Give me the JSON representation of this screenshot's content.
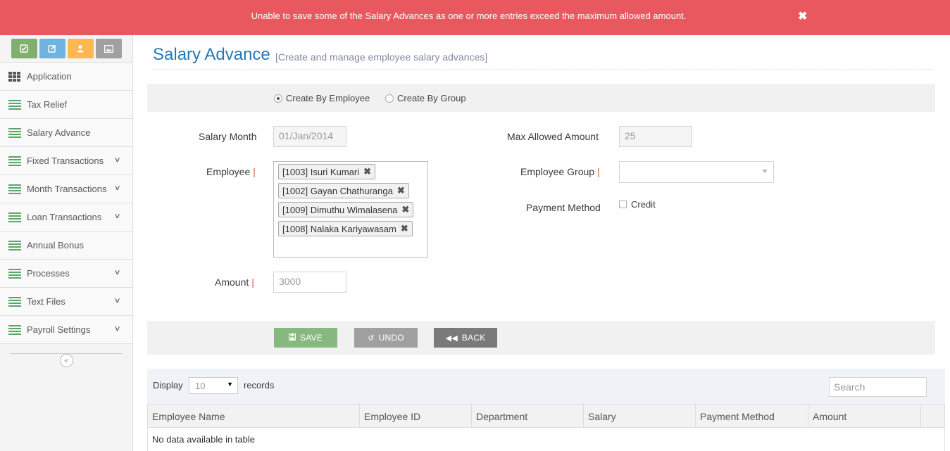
{
  "alert": {
    "message": "Unable to save some of the Salary Advances as one or more entries exceed the maximum allowed amount.",
    "close_icon": "close-icon"
  },
  "sidebar": {
    "shortcuts": [
      {
        "name": "check-square-icon",
        "color": "#82af6f"
      },
      {
        "name": "edit-icon",
        "color": "#6fb3e0"
      },
      {
        "name": "user-icon",
        "color": "#ffb752"
      },
      {
        "name": "picture-icon",
        "color": "#a0a0a0"
      }
    ],
    "items": [
      {
        "label": "Application",
        "icon": "grid-icon",
        "has_submenu": false
      },
      {
        "label": "Tax Relief",
        "icon": "list-icon",
        "has_submenu": false
      },
      {
        "label": "Salary Advance",
        "icon": "list-icon",
        "has_submenu": false
      },
      {
        "label": "Fixed Transactions",
        "icon": "list-icon",
        "has_submenu": true
      },
      {
        "label": "Month Transactions",
        "icon": "list-icon",
        "has_submenu": true
      },
      {
        "label": "Loan Transactions",
        "icon": "list-icon",
        "has_submenu": true
      },
      {
        "label": "Annual Bonus",
        "icon": "list-icon",
        "has_submenu": false
      },
      {
        "label": "Processes",
        "icon": "list-icon",
        "has_submenu": true
      },
      {
        "label": "Text Files",
        "icon": "list-icon",
        "has_submenu": true
      },
      {
        "label": "Payroll Settings",
        "icon": "list-icon",
        "has_submenu": true
      }
    ]
  },
  "page": {
    "title": "Salary Advance",
    "subtitle": "[Create and manage employee salary advances]"
  },
  "create_mode": {
    "by_employee_label": "Create By Employee",
    "by_group_label": "Create By Group",
    "selected": "by_employee"
  },
  "form": {
    "salary_month_label": "Salary Month",
    "salary_month_value": "01/Jan/2014",
    "max_allowed_label": "Max Allowed Amount",
    "max_allowed_value": "25",
    "employee_label": "Employee",
    "employees": [
      "[1003] Isuri Kumari",
      "[1002] Gayan Chathuranga",
      "[1009] Dimuthu Wimalasena",
      "[1008] Nalaka Kariyawasam"
    ],
    "employee_group_label": "Employee Group",
    "employee_group_value": "",
    "payment_method_label": "Payment Method",
    "credit_label": "Credit",
    "credit_checked": false,
    "amount_label": "Amount",
    "amount_value": "3000",
    "required_mark": "|"
  },
  "actions": {
    "save_label": "SAVE",
    "undo_label": "UNDO",
    "back_label": "BACK"
  },
  "table": {
    "display_label": "Display",
    "page_size": "10",
    "records_label": "records",
    "search_placeholder": "Search",
    "columns": [
      "Employee Name",
      "Employee ID",
      "Department",
      "Salary",
      "Payment Method",
      "Amount"
    ],
    "empty_message": "No data available in table"
  }
}
